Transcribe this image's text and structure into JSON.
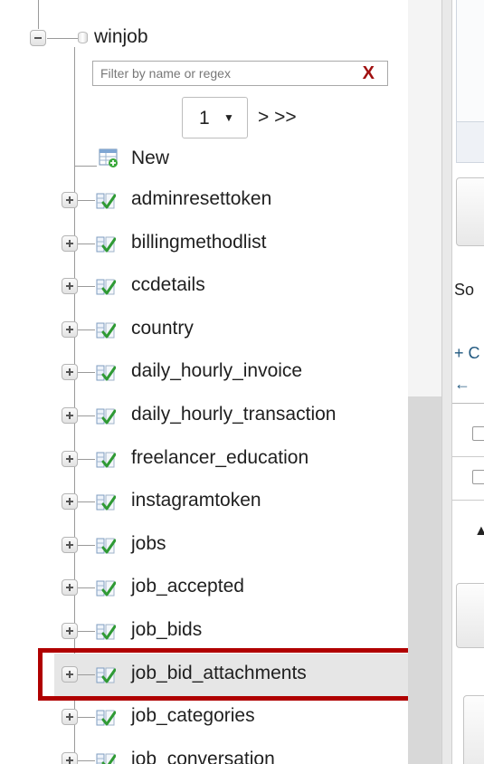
{
  "tree": {
    "database": {
      "name": "winjob"
    },
    "filter": {
      "placeholder": "Filter by name or regex",
      "value": "",
      "clear_label": "X"
    },
    "pager": {
      "selected": "1",
      "caret": "▼",
      "next_label": "> >>"
    },
    "new_item": {
      "label": "New"
    },
    "tables": [
      {
        "label": "adminresettoken"
      },
      {
        "label": "billingmethodlist"
      },
      {
        "label": "ccdetails"
      },
      {
        "label": "country"
      },
      {
        "label": "daily_hourly_invoice"
      },
      {
        "label": "daily_hourly_transaction"
      },
      {
        "label": "freelancer_education"
      },
      {
        "label": "instagramtoken"
      },
      {
        "label": "jobs"
      },
      {
        "label": "job_accepted"
      },
      {
        "label": "job_bids"
      },
      {
        "label": "job_bid_attachments",
        "highlighted": true
      },
      {
        "label": "job_categories"
      },
      {
        "label": "job_conversation"
      }
    ]
  },
  "right_panel": {
    "sort_text": "So",
    "add_link": "+ C",
    "arrow_text": "←"
  },
  "colors": {
    "highlight_border": "#b00000",
    "clear_x": "#a01010",
    "link": "#235a81"
  }
}
